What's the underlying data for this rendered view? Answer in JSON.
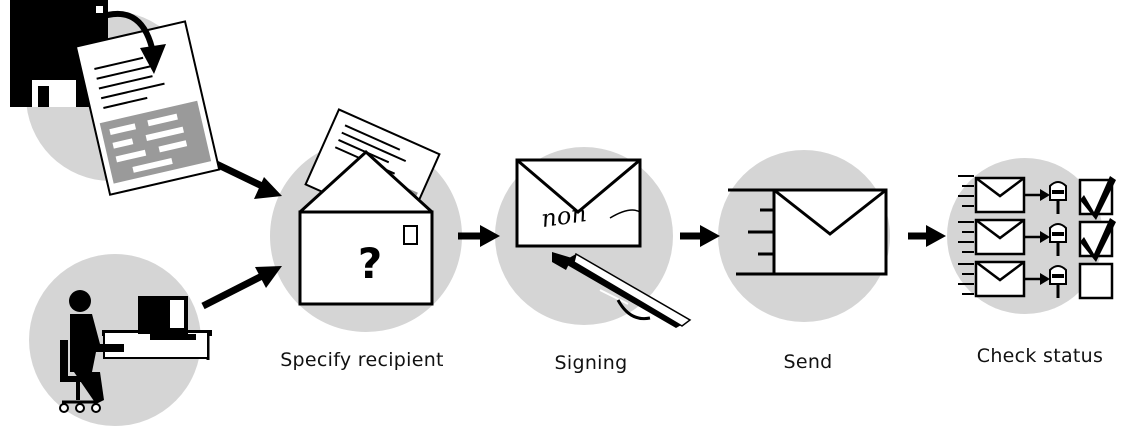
{
  "diagram": {
    "steps": [
      {
        "label": "Specify recipient"
      },
      {
        "label": "Signing"
      },
      {
        "label": "Send"
      },
      {
        "label": "Check status"
      }
    ],
    "envelope_mark": "?",
    "signature_text": "non",
    "colors": {
      "circle": "#d5d5d5",
      "ink": "#000000",
      "paper": "#ffffff",
      "form_panel": "#9a9a9a"
    }
  }
}
